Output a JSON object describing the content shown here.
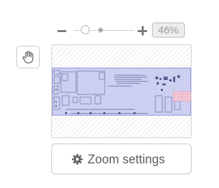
{
  "zoom": {
    "level_label": "46%",
    "slider_value": 0.46,
    "minus_icon": "minus-icon",
    "plus_icon": "plus-icon"
  },
  "tools": {
    "pan_icon": "hand-icon"
  },
  "preview": {
    "viewport_color": "#c6c8f0",
    "viewport_border": "#8f94d8"
  },
  "settings_button": {
    "label": "Zoom settings",
    "icon": "gear-icon"
  }
}
